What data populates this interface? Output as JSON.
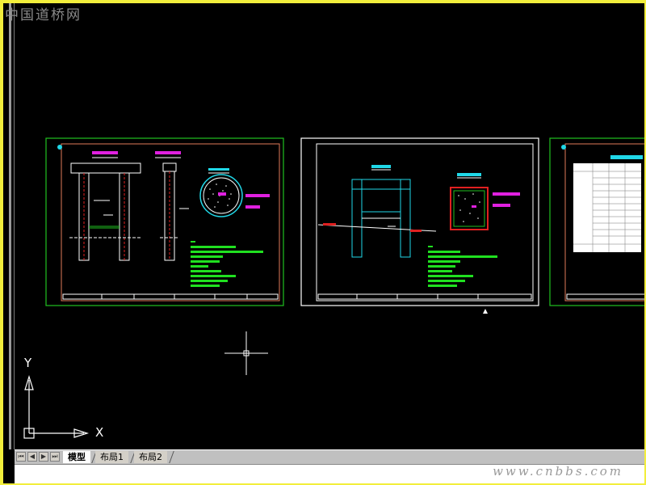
{
  "watermark": {
    "top_left": "中国道桥网",
    "bottom_right": "www.cnbbs.com"
  },
  "ucs": {
    "y_label": "Y",
    "x_label": "X"
  },
  "tabs": {
    "items": [
      {
        "label": "模型",
        "active": true
      },
      {
        "label": "布局1",
        "active": false
      },
      {
        "label": "布局2",
        "active": false
      }
    ]
  },
  "colors": {
    "background": "#000000",
    "frame": "#f2ee3c",
    "sheet_green": "#20c020",
    "sheet_white": "#ffffff",
    "accent_magenta": "#e020e0",
    "accent_cyan": "#20d8e8",
    "accent_red": "#e02020",
    "accent_green_text": "#20e020"
  }
}
